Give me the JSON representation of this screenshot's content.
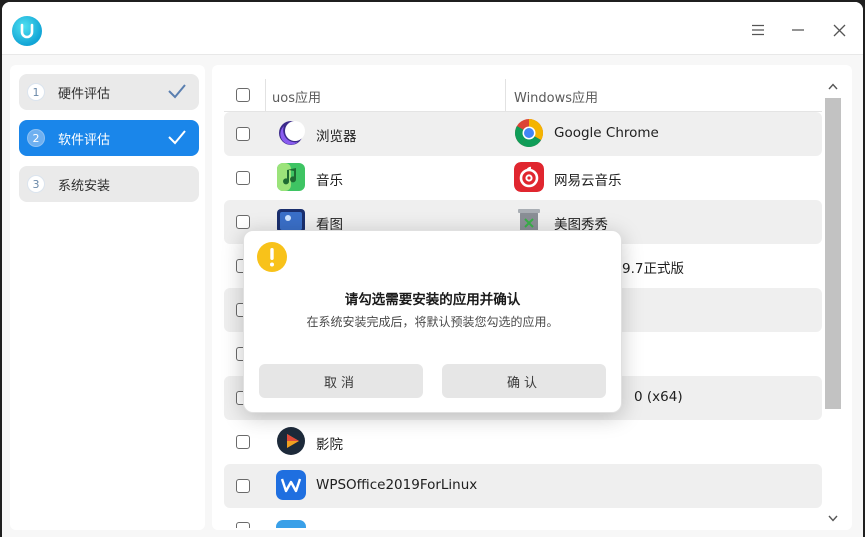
{
  "window": {
    "logo_icon": "uos-logo-icon",
    "controls": [
      "menu-icon",
      "minimize-icon",
      "close-icon"
    ]
  },
  "sidebar": {
    "steps": [
      {
        "num": "1",
        "label": "硬件评估",
        "done": true,
        "active": false
      },
      {
        "num": "2",
        "label": "软件评估",
        "done": true,
        "active": true
      },
      {
        "num": "3",
        "label": "系统安装",
        "done": false,
        "active": false
      }
    ]
  },
  "table": {
    "headers": {
      "uos": "uos应用",
      "windows": "Windows应用"
    },
    "rows": [
      {
        "uos": "浏览器",
        "uos_icon": "browser-icon",
        "windows": "Google Chrome",
        "win_icon": "chrome-icon"
      },
      {
        "uos": "音乐",
        "uos_icon": "music-icon",
        "windows": "网易云音乐",
        "win_icon": "netease-music-icon"
      },
      {
        "uos": "看图",
        "uos_icon": "image-viewer-icon",
        "windows": "美图秀秀",
        "win_icon": "meitu-icon"
      },
      {
        "uos": "",
        "uos_icon": "",
        "windows": "9.7正式版",
        "win_icon": ""
      },
      {
        "uos": "",
        "uos_icon": "",
        "windows": "",
        "win_icon": ""
      },
      {
        "uos": "",
        "uos_icon": "",
        "windows": "",
        "win_icon": ""
      },
      {
        "uos": "",
        "uos_icon": "app-icon",
        "windows": "0 (x64)",
        "win_icon": ""
      },
      {
        "uos": "影院",
        "uos_icon": "movie-icon",
        "windows": "",
        "win_icon": ""
      },
      {
        "uos": "WPSOffice2019ForLinux",
        "uos_icon": "wps-icon",
        "windows": "",
        "win_icon": ""
      }
    ]
  },
  "dialog": {
    "icon": "warning-icon",
    "title": "请勾选需要安装的应用并确认",
    "message": "在系统安装完成后，将默认预装您勾选的应用。",
    "cancel_label": "取消",
    "confirm_label": "确认"
  },
  "colors": {
    "accent": "#1a86ea",
    "warning": "#f8c21a",
    "row_alt": "#efefef"
  }
}
